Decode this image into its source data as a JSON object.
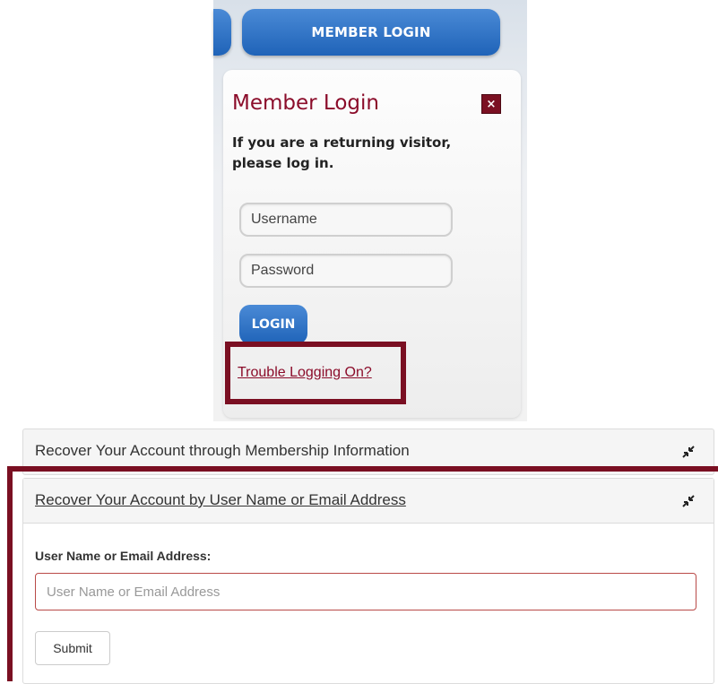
{
  "login_widget": {
    "nav_tab_label": "MEMBER LOGIN",
    "title": "Member Login",
    "close_label": "×",
    "intro_text": "If you are a returning visitor, please log in.",
    "username_placeholder": "Username",
    "password_placeholder": "Password",
    "login_button_label": "LOGIN",
    "trouble_link_label": "Trouble Logging On?"
  },
  "recovery": {
    "sections": [
      {
        "title": "Recover Your Account through Membership Information",
        "collapse_icon": "compress-arrows-icon"
      },
      {
        "title": "Recover Your Account by User Name or Email Address",
        "collapse_icon": "compress-arrows-icon"
      }
    ],
    "field_label": "User Name or Email Address:",
    "field_placeholder": "User Name or Email Address",
    "submit_label": "Submit"
  },
  "colors": {
    "brand_maroon": "#8b0c2a",
    "highlight_border": "#7a0f22",
    "button_blue": "#1f63b8"
  }
}
